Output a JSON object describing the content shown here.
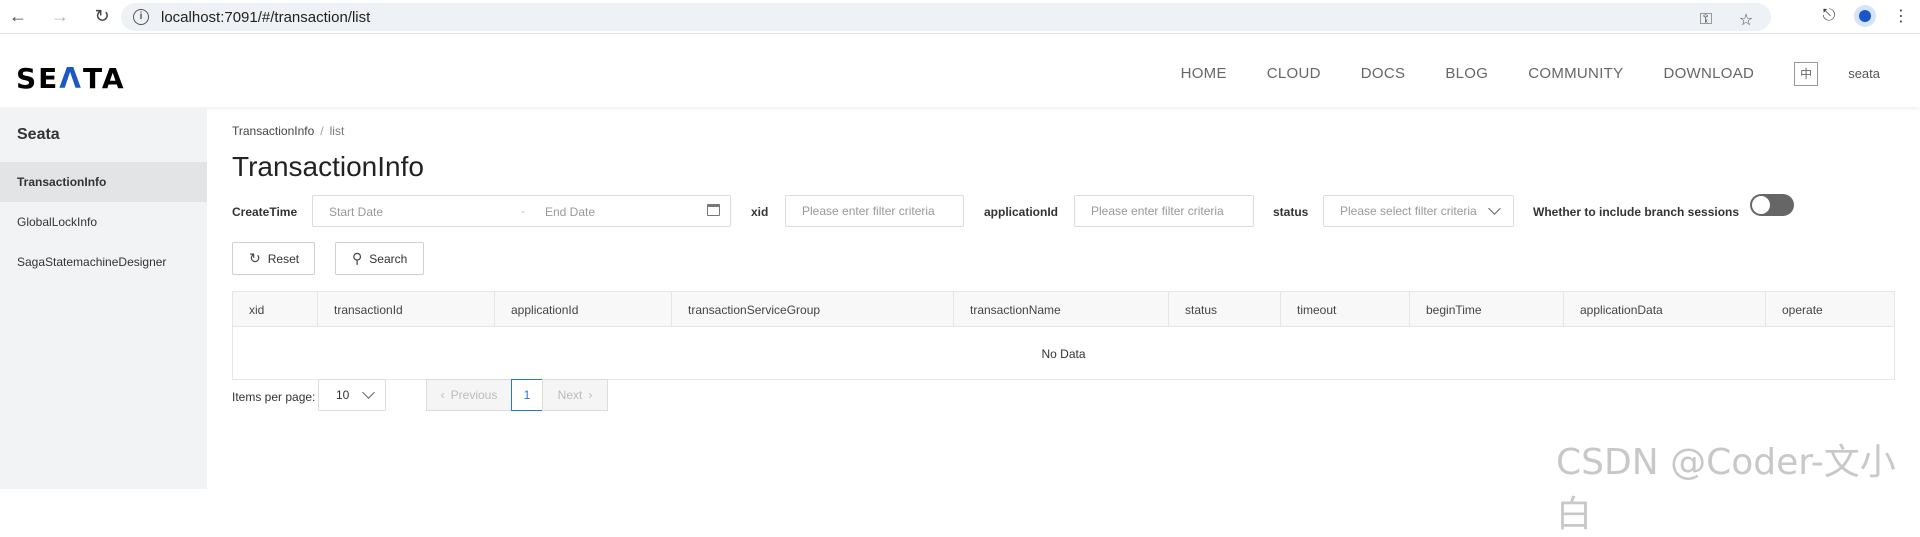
{
  "browser": {
    "url": "localhost:7091/#/transaction/list",
    "back_icon": "arrow-left-icon",
    "forward_icon": "arrow-right-icon",
    "reload_icon": "reload-icon"
  },
  "header": {
    "logo_prefix": "SE",
    "logo_mid": "Λ",
    "logo_suffix": "TA",
    "nav": [
      "HOME",
      "CLOUD",
      "DOCS",
      "BLOG",
      "COMMUNITY",
      "DOWNLOAD"
    ],
    "lang": "中",
    "user": "seata"
  },
  "sidebar": {
    "title": "Seata",
    "items": [
      {
        "label": "TransactionInfo",
        "active": true
      },
      {
        "label": "GlobalLockInfo",
        "active": false
      },
      {
        "label": "SagaStatemachineDesigner",
        "active": false
      }
    ]
  },
  "breadcrumb": {
    "parent": "TransactionInfo",
    "sep": "/",
    "current": "list"
  },
  "page_title": "TransactionInfo",
  "filters": {
    "create_time_label": "CreateTime",
    "start_placeholder": "Start Date",
    "range_sep": "-",
    "end_placeholder": "End Date",
    "xid_label": "xid",
    "xid_placeholder": "Please enter filter criteria",
    "application_label": "applicationId",
    "application_placeholder": "Please enter filter criteria",
    "status_label": "status",
    "status_placeholder": "Please select filter criteria",
    "branch_label": "Whether to include branch sessions",
    "branch_on": false
  },
  "actions": {
    "reset": "Reset",
    "search": "Search"
  },
  "table": {
    "columns": [
      "xid",
      "transactionId",
      "applicationId",
      "transactionServiceGroup",
      "transactionName",
      "status",
      "timeout",
      "beginTime",
      "applicationData",
      "operate"
    ],
    "empty": "No Data"
  },
  "pagination": {
    "label": "Items per page:",
    "page_size": "10",
    "previous": "Previous",
    "current": "1",
    "next": "Next"
  },
  "watermark": "CSDN @Coder-文小白",
  "colors": {
    "accent": "#2277d8",
    "logo_blue": "#1b57c7"
  }
}
